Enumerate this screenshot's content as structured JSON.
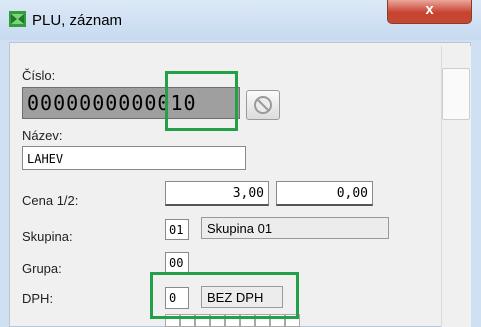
{
  "window": {
    "title": "PLU, záznam",
    "close_glyph": "x"
  },
  "cislo": {
    "label": "Číslo:",
    "value": "0000000000010",
    "search_icon": "no-entry-icon"
  },
  "nazev": {
    "label": "Název:",
    "value": "LAHEV"
  },
  "cena": {
    "label": "Cena 1/2:",
    "value1": "3,00",
    "value2": "0,00"
  },
  "skupina": {
    "label": "Skupina:",
    "code": "01",
    "name": "Skupina 01"
  },
  "grupa": {
    "label": "Grupa:",
    "code": "00"
  },
  "dph": {
    "label": "DPH:",
    "code": "0",
    "name": "BEZ DPH"
  },
  "colors": {
    "highlight": "#23a14a",
    "title_bar": "#cfe0f2",
    "close_button": "#c7422f"
  }
}
